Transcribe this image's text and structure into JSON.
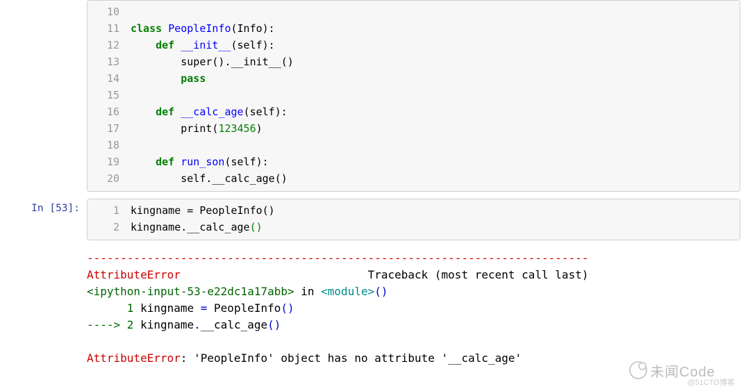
{
  "cells": {
    "c0": {
      "prompt": "",
      "gutter": [
        "10",
        "11",
        "12",
        "13",
        "14",
        "15",
        "16",
        "17",
        "18",
        "19",
        "20"
      ]
    },
    "c1": {
      "prompt": "In [53]:",
      "gutter": [
        "1",
        "2"
      ]
    }
  },
  "code": {
    "kw_class": "class",
    "cls_name": "PeopleInfo",
    "base_name": "Info",
    "kw_def": "def",
    "m_init": "__init__",
    "p_self": "self",
    "call_super": "super",
    "attr_init": "__init__",
    "kw_pass": "pass",
    "m_calc": "__calc_age",
    "fn_print": "print",
    "num_lit": "123456",
    "m_runson": "run_son",
    "self_attr": "self",
    "calc_attr": "__calc_age",
    "var_king": "kingname",
    "eq": " = ",
    "ctor": "PeopleInfo",
    "call_calc": "__calc_age"
  },
  "err": {
    "dashes": "---------------------------------------------------------------------------",
    "err_name": "AttributeError",
    "trace_label": "Traceback (most recent call last)",
    "src_open": "<ipython-input-53-e22dc1a17abb>",
    "in_word": " in ",
    "module": "<module>",
    "paren_g": "()",
    "l1_pre": "      1",
    "l1_code_a": " kingname ",
    "l1_code_b": "=",
    "l1_code_c": " PeopleInfo",
    "l1_code_d": "()",
    "arrow": "----> ",
    "l2_num": "2",
    "l2_code_a": " kingname",
    "l2_code_b": ".",
    "l2_code_c": "__calc_age",
    "l2_code_d": "()",
    "final_err": "AttributeError",
    "final_msg": ": 'PeopleInfo' object has no attribute '__calc_age'"
  },
  "watermark": {
    "main": "未闻Code",
    "sub": "@51CTO博客"
  }
}
